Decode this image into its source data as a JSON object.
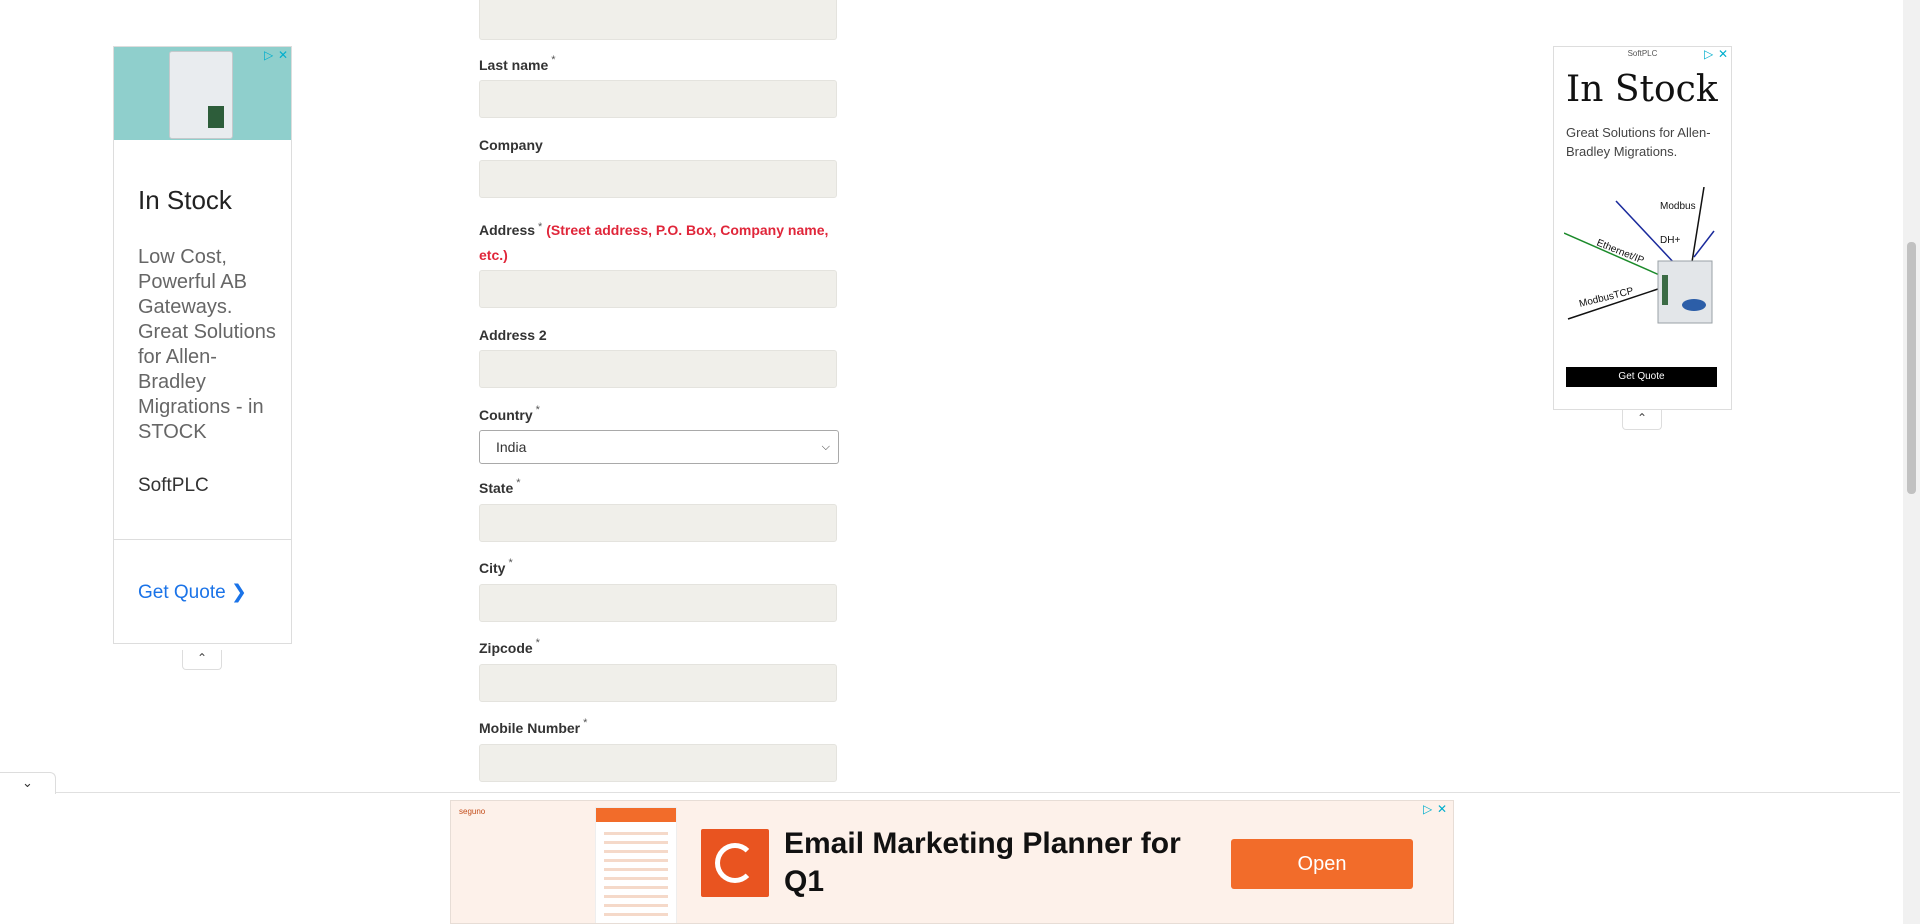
{
  "form": {
    "last_name_label": "Last name",
    "company_label": "Company",
    "address_label": "Address",
    "address_hint": "(Street address, P.O. Box, Company name, etc.)",
    "address2_label": "Address 2",
    "country_label": "Country",
    "country_value": "India",
    "state_label": "State",
    "city_label": "City",
    "zipcode_label": "Zipcode",
    "mobile_label": "Mobile Number",
    "required_mark": "*"
  },
  "ad_left": {
    "headline": "In Stock",
    "description": "Low Cost, Powerful AB Gateways. Great Solutions for Allen-Bradley Migrations - in STOCK",
    "brand": "SoftPLC",
    "cta": "Get Quote"
  },
  "ad_right": {
    "brand": "SoftPLC",
    "headline": "In Stock",
    "description": "Great Solutions for Allen-Bradley Migrations.",
    "labels": [
      "Modbus",
      "DH+",
      "Ethernet/IP",
      "ModbusTCP"
    ],
    "cta": "Get Quote"
  },
  "ad_bottom": {
    "brand": "seguno",
    "title": "Email Marketing Planner for Q1",
    "cta": "Open"
  },
  "icons": {
    "adchoices": "adchoices-icon",
    "close": "close-icon",
    "chevron_up": "chevron-up-icon",
    "chevron_down": "chevron-down-icon"
  },
  "colors": {
    "input_bg": "#f0efea",
    "hint_red": "#e0263a",
    "link_blue": "#1a73e8",
    "seguno_orange": "#f26c2a"
  }
}
